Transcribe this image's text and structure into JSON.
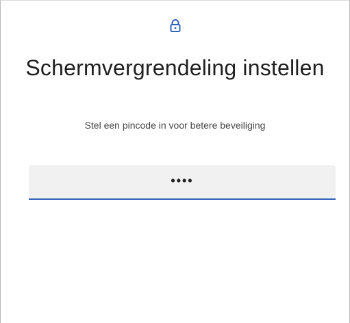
{
  "header": {
    "icon": "lock-icon"
  },
  "main": {
    "title": "Schermvergrendeling instellen",
    "subtitle": "Stel een pincode in voor betere beveiliging",
    "pin_field": {
      "value": "••••"
    }
  },
  "colors": {
    "accent": "#2f63b8",
    "field_background": "#f0f1f0",
    "icon": "#2f63b8"
  }
}
